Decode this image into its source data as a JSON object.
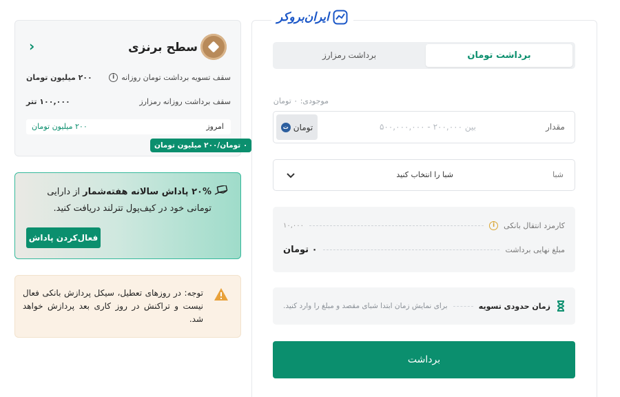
{
  "brand": {
    "logo_text": "ایران‌بروکر"
  },
  "level_card": {
    "title": "سطح برنزی",
    "rows": [
      {
        "label": "سقف تسویه برداشت تومان روزانه",
        "value": "۲۰۰ میلیون تومان"
      },
      {
        "label": "سقف برداشت روزانه رمزارز",
        "value": "۱۰۰,۰۰۰ تتر"
      }
    ],
    "today_label": "امروز",
    "today_value": "۲۰۰ میلیون تومان",
    "usage_pill": "۰ تومان/۲۰۰ میلیون تومان"
  },
  "promo": {
    "highlight": "۲۰% پاداش سالانه هفته‌شمار",
    "text": " از دارایی تومانی خود در کیف‌پول تترلند دریافت کنید.",
    "button": "فعال‌کردن پاداش"
  },
  "warning": {
    "text": "توجه: در روزهای تعطیل، سیکل پردازش بانکی فعال نیست و تراکنش در روز کاری بعد پردازش خواهد شد."
  },
  "tabs": {
    "active": "برداشت تومان",
    "inactive": "برداشت رمزارز"
  },
  "form": {
    "balance": "موجودی: ۰ تومان",
    "amount_label": "مقدار",
    "amount_placeholder": "بین ۲۰۰,۰۰۰ - ۵۰۰,۰۰۰,۰۰۰",
    "currency_chip": "تومان",
    "sheba_label": "شبا",
    "sheba_select": "شبا را انتخاب کنید",
    "fee_label": "کارمزد انتقال بانکی",
    "fee_value": "۱۰,۰۰۰",
    "final_label": "مبلغ نهایی برداشت",
    "final_value": "۰ تومان",
    "time_label": "زمان حدودی تسویه",
    "time_desc": "برای نمایش زمان ابتدا شبای مقصد و مبلغ را وارد کنید.",
    "submit": "برداشت"
  },
  "colors": {
    "primary": "#0b8f6e",
    "brand_blue": "#1a56c7",
    "warning": "#e8a13a"
  }
}
